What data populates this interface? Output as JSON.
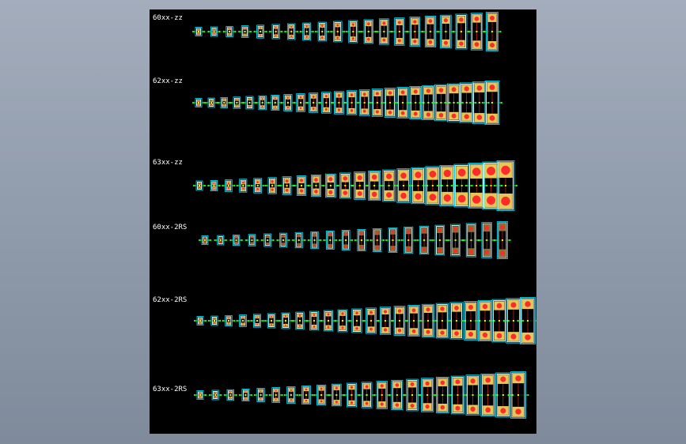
{
  "drawing": {
    "background_color": "#000000",
    "colors": {
      "outline": "#00e5ff",
      "race": "#ffffff",
      "fill": "#f2d35c",
      "axis": "#ff2a2a",
      "center": "#ffee00",
      "dim": "#22ff22"
    },
    "rows": [
      {
        "label": "60xx-zz",
        "count": 20,
        "fill": "partial"
      },
      {
        "label": "62xx-zz",
        "count": 24,
        "fill": "partial"
      },
      {
        "label": "63xx-zz",
        "count": 22,
        "fill": "full"
      },
      {
        "label": "60xx-2RS",
        "count": 20,
        "fill": "light"
      },
      {
        "label": "62xx-2RS",
        "count": 24,
        "fill": "partial"
      },
      {
        "label": "63xx-2RS",
        "count": 22,
        "fill": "partial"
      }
    ]
  }
}
